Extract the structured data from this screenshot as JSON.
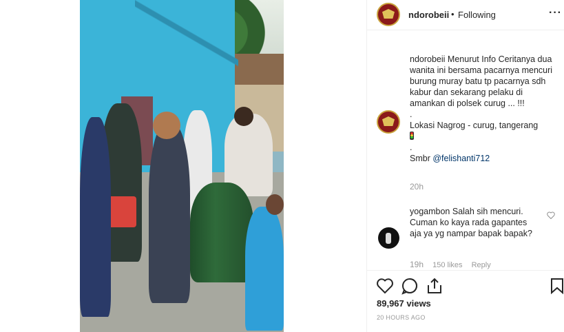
{
  "post": {
    "username": "ndorobeii",
    "dot": "•",
    "follow_status": "Following",
    "more_label": "···"
  },
  "caption": {
    "username": "ndorobeii",
    "line1": "Menurut Info Ceritanya dua wanita ini bersama pacarnya mencuri burung muray batu tp pacarnya sdh kabur dan sekarang pelaku di amankan di polsek curug ... !!!",
    "dot1": ".",
    "location": "Lokasi Nagrog - curug, tangerang",
    "dot2": ".",
    "source_label": "Smbr",
    "source_mention": "@felishanti712",
    "time": "20h"
  },
  "comments": [
    {
      "username": "yogambon",
      "text": "Salah sih mencuri. Cuman ko kaya rada gapantes aja ya yg nampar bapak bapak?",
      "time": "19h",
      "likes": "150 likes",
      "reply_label": "Reply"
    }
  ],
  "stats": {
    "views": "89,967 views",
    "posted_ago": "20 HOURS AGO"
  },
  "icons": {
    "like": "heart-icon",
    "comment": "comment-icon",
    "share": "share-icon",
    "save": "bookmark-icon",
    "more": "more-icon",
    "comment_like": "heart-icon"
  }
}
